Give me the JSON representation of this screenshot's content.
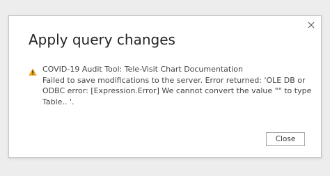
{
  "dialog": {
    "title": "Apply query changes",
    "message": {
      "heading": "COVID-19 Audit Tool: Tele-Visit Chart Documentation",
      "lines": [
        "Failed to save modifications to the server. Error returned: 'OLE DB or",
        "ODBC error: [Expression.Error] We cannot convert the value \"\" to type",
        "Table.. '."
      ]
    },
    "icons": {
      "close": "close-icon",
      "warning": "warning-icon"
    },
    "close_button_label": "Close"
  },
  "colors": {
    "warning": "#e8a317",
    "text": "#444444",
    "title": "#252423",
    "background": "#ededed"
  }
}
